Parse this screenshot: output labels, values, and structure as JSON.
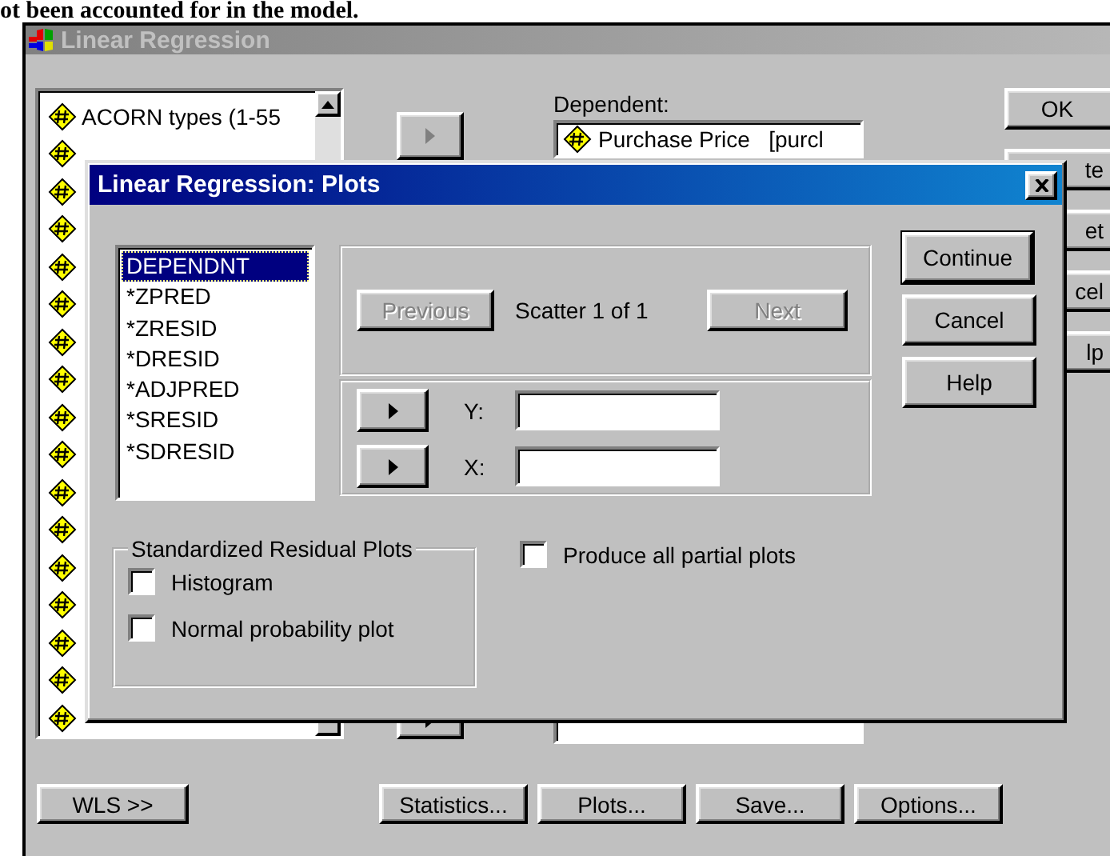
{
  "caption": "ot been accounted for in the model.",
  "window": {
    "title": "Linear Regression",
    "active": false
  },
  "variables": [
    {
      "kind": "scale",
      "label": "ACORN types (1-55"
    },
    {
      "kind": "scale"
    },
    {
      "kind": "scale"
    },
    {
      "kind": "scale"
    },
    {
      "kind": "scale"
    },
    {
      "kind": "scale"
    },
    {
      "kind": "scale"
    },
    {
      "kind": "scale"
    },
    {
      "kind": "scale"
    },
    {
      "kind": "scale"
    },
    {
      "kind": "scale"
    },
    {
      "kind": "scale"
    },
    {
      "kind": "scale"
    },
    {
      "kind": "scale"
    },
    {
      "kind": "scale"
    },
    {
      "kind": "scale"
    },
    {
      "kind": "scale"
    }
  ],
  "dependent": {
    "label": "Dependent:",
    "value": "Purchase Price   [purcl"
  },
  "side_buttons": [
    {
      "label": "OK"
    },
    {
      "label": "te"
    },
    {
      "label": "et"
    },
    {
      "label": "cel"
    },
    {
      "label": "lp"
    }
  ],
  "bottom_buttons": [
    "WLS >>",
    "Statistics...",
    "Plots...",
    "Save...",
    "Options..."
  ],
  "dialog": {
    "title": "Linear Regression: Plots",
    "active": true,
    "variables": [
      {
        "label": "DEPENDNT",
        "selected": true
      },
      {
        "label": "*ZPRED",
        "selected": false
      },
      {
        "label": "*ZRESID",
        "selected": false
      },
      {
        "label": "*DRESID",
        "selected": false
      },
      {
        "label": "*ADJPRED",
        "selected": false
      },
      {
        "label": "*SRESID",
        "selected": false
      },
      {
        "label": "*SDRESID",
        "selected": false
      }
    ],
    "scatter": {
      "previous": {
        "label": "Previous",
        "disabled": true
      },
      "counter": "Scatter 1 of 1",
      "next": {
        "label": "Next",
        "disabled": true
      },
      "fields": [
        {
          "label": "Y:"
        },
        {
          "label": "X:"
        }
      ]
    },
    "buttons": [
      {
        "label": "Continue",
        "default": true
      },
      {
        "label": "Cancel",
        "default": false
      },
      {
        "label": "Help",
        "default": false
      }
    ],
    "residual_group": {
      "title": "Standardized Residual Plots",
      "options": [
        {
          "label": "Histogram",
          "checked": false
        },
        {
          "label": "Normal probability plot",
          "checked": false
        }
      ]
    },
    "partial_plots": {
      "label": "Produce all partial plots",
      "checked": false
    }
  }
}
